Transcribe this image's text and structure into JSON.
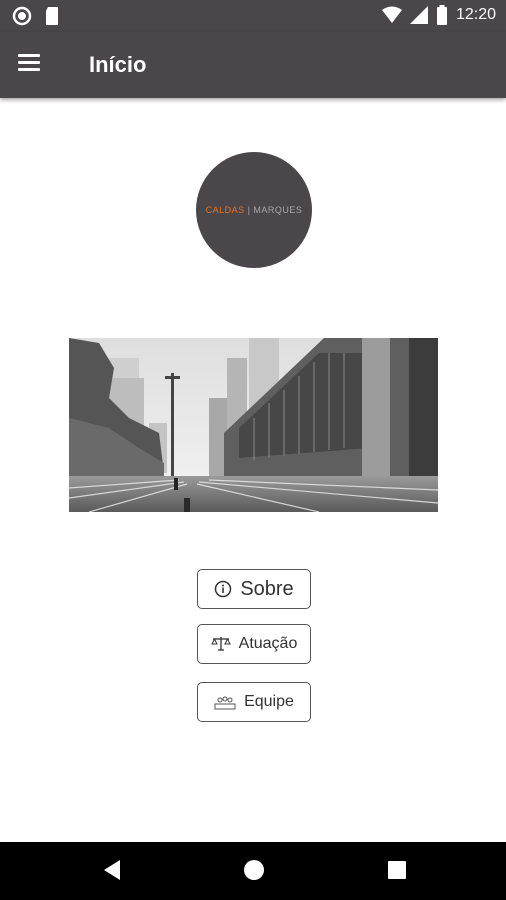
{
  "status_bar": {
    "time": "12:20",
    "icons": [
      "record-icon",
      "sd-card-icon",
      "wifi-icon",
      "signal-icon",
      "battery-icon"
    ]
  },
  "app_bar": {
    "title": "Início",
    "menu_icon": "hamburger-menu-icon"
  },
  "logo": {
    "brand_part1": "CALDAS",
    "separator": "|",
    "brand_part2": "MARQUES",
    "colors": {
      "accent": "#e0762c",
      "secondary": "#a9a5a8",
      "background": "#4a4649"
    }
  },
  "hero_image": {
    "description_icon": "city-avenue-photo"
  },
  "menu_buttons": [
    {
      "label": "Sobre",
      "icon": "info-icon"
    },
    {
      "label": "Atuação",
      "icon": "scales-icon"
    },
    {
      "label": "Equipe",
      "icon": "team-icon"
    }
  ],
  "nav_bar": {
    "icons": [
      "back-icon",
      "home-icon",
      "recents-icon"
    ]
  }
}
